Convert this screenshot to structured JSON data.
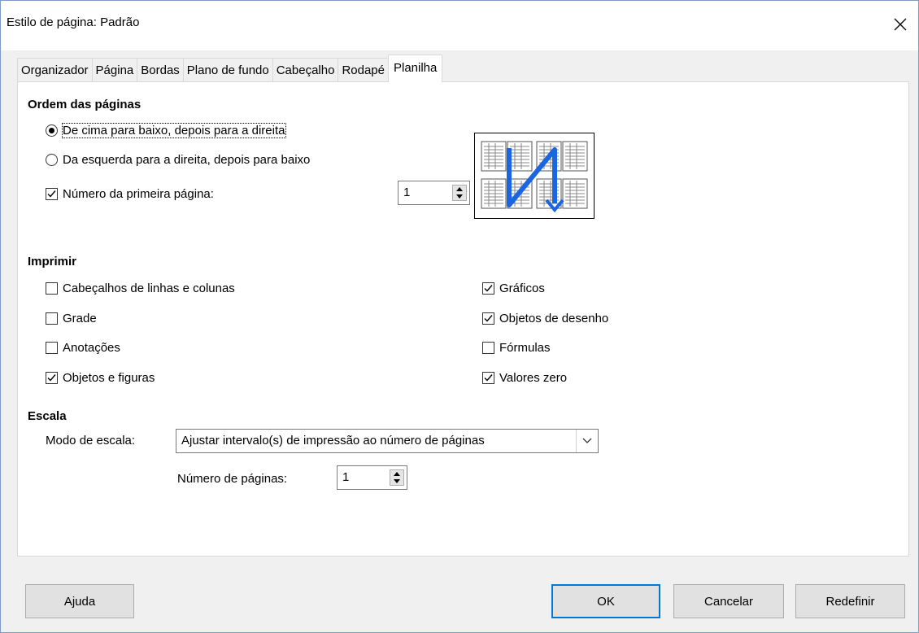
{
  "window": {
    "title": "Estilo de página: Padrão"
  },
  "tabs": [
    {
      "label": "Organizador",
      "active": false
    },
    {
      "label": "Página",
      "active": false
    },
    {
      "label": "Bordas",
      "active": false
    },
    {
      "label": "Plano de fundo",
      "active": false
    },
    {
      "label": "Cabeçalho",
      "active": false
    },
    {
      "label": "Rodapé",
      "active": false
    },
    {
      "label": "Planilha",
      "active": true
    }
  ],
  "page_order": {
    "heading": "Ordem das páginas",
    "options": [
      {
        "label": "De cima para baixo, depois para a direita",
        "selected": true
      },
      {
        "label": "Da esquerda para a direita, depois para baixo",
        "selected": false
      }
    ],
    "first_page": {
      "label": "Número da primeira página:",
      "checked": true,
      "value": "1"
    }
  },
  "print": {
    "heading": "Imprimir",
    "left": [
      {
        "label": "Cabeçalhos de linhas e colunas",
        "checked": false
      },
      {
        "label": "Grade",
        "checked": false
      },
      {
        "label": "Anotações",
        "checked": false
      },
      {
        "label": "Objetos e figuras",
        "checked": true
      }
    ],
    "right": [
      {
        "label": "Gráficos",
        "checked": true
      },
      {
        "label": "Objetos de desenho",
        "checked": true
      },
      {
        "label": "Fórmulas",
        "checked": false
      },
      {
        "label": "Valores zero",
        "checked": true
      }
    ]
  },
  "scale": {
    "heading": "Escala",
    "mode_label": "Modo de escala:",
    "mode_value": "Ajustar intervalo(s) de impressão ao número de páginas",
    "pages_label": "Número de páginas:",
    "pages_value": "1"
  },
  "buttons": {
    "help": "Ajuda",
    "ok": "OK",
    "cancel": "Cancelar",
    "reset": "Redefinir"
  },
  "colors": {
    "accent": "#0078d7",
    "arrow": "#1a66e0"
  }
}
